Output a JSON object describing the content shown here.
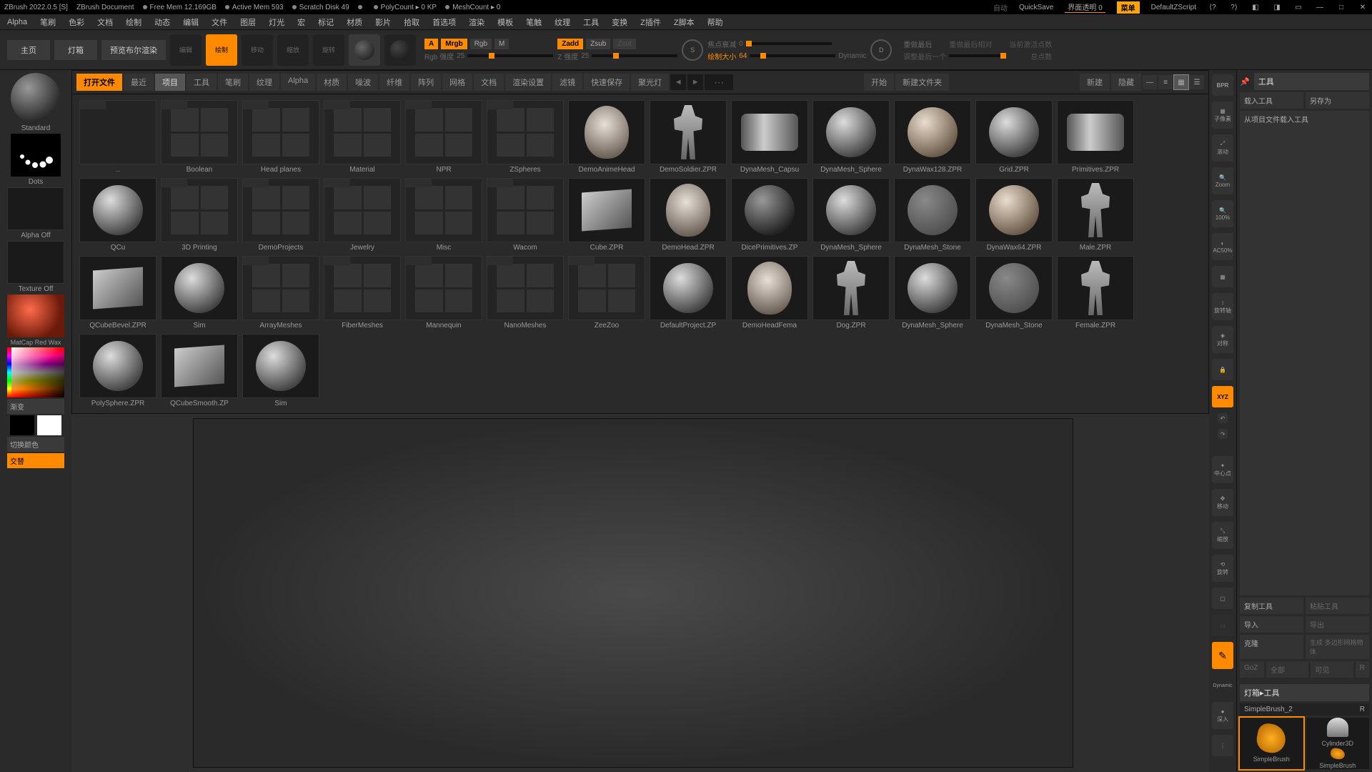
{
  "titlebar": {
    "app": "ZBrush 2022.0.5 [S]",
    "doc": "ZBrush Document",
    "freemem": "Free Mem 12.169GB",
    "activemem": "Active Mem 593",
    "scratch": "Scratch Disk 49",
    "polycount": "PolyCount ▸ 0 KP",
    "meshcount": "MeshCount ▸ 0",
    "auto": "自动",
    "quicksave": "QuickSave",
    "uialpha_label": "界面透明",
    "uialpha_val": "0",
    "menu": "菜单",
    "defaultscript": "DefaultZScript"
  },
  "topmenu": [
    "Alpha",
    "笔刷",
    "色彩",
    "文档",
    "绘制",
    "动态",
    "编辑",
    "文件",
    "图层",
    "灯光",
    "宏",
    "标记",
    "材质",
    "影片",
    "拾取",
    "首选项",
    "渲染",
    "模板",
    "笔触",
    "纹理",
    "工具",
    "变换",
    "Z插件",
    "Z脚本",
    "帮助"
  ],
  "tooltop": {
    "home": "主页",
    "lightbox": "灯箱",
    "bpr_preview": "预览布尔渲染",
    "edit": "编辑",
    "draw": "绘制",
    "move": "移动",
    "scale": "缩放",
    "rotate": "旋转",
    "a_label": "A",
    "mrgb": "Mrgb",
    "rgb": "Rgb",
    "m": "M",
    "zadd": "Zadd",
    "zsub": "Zsub",
    "zcut": "Zcut",
    "rgb_intensity_label": "Rgb 强度",
    "rgb_intensity_val": "25",
    "z_intensity_label": "Z 强度",
    "z_intensity_val": "25",
    "focal_label": "焦点衰减",
    "focal_val": "0",
    "size_label": "绘制大小",
    "size_val": "64",
    "dynamic": "Dynamic",
    "s_circle": "S",
    "d_circle": "D",
    "redo_last": "重做最后",
    "redo_rel": "重做最后相对",
    "cur_active": "当前激活点数",
    "adjust_last": "调整最后一个",
    "total_pts": "总点数"
  },
  "browser": {
    "open": "打开文件",
    "tabs": [
      "最近",
      "项目",
      "工具",
      "笔刷",
      "纹理",
      "Alpha",
      "材质",
      "噪波",
      "纤维",
      "阵列",
      "网格",
      "文档",
      "渲染设置",
      "滤镜",
      "快速保存",
      "聚光灯"
    ],
    "active_tab_index": 1,
    "start": "开始",
    "newfolder": "新建文件夹",
    "new": "新建",
    "hide": "隐藏",
    "items": [
      {
        "label": "..",
        "type": "folder"
      },
      {
        "label": "Boolean",
        "type": "folder-thumb"
      },
      {
        "label": "Head planes",
        "type": "folder-thumb"
      },
      {
        "label": "Material",
        "type": "folder-thumb"
      },
      {
        "label": "NPR",
        "type": "folder-thumb"
      },
      {
        "label": "ZSpheres",
        "type": "folder-thumb"
      },
      {
        "label": "DemoAnimeHead",
        "type": "head"
      },
      {
        "label": "DemoSoldier.ZPR",
        "type": "body"
      },
      {
        "label": "DynaMesh_Capsu",
        "type": "cyl"
      },
      {
        "label": "DynaMesh_Sphere",
        "type": "sphere"
      },
      {
        "label": "DynaWax128.ZPR",
        "type": "sphere-warm"
      },
      {
        "label": "Grid.ZPR",
        "type": "sphere"
      },
      {
        "label": "Primitives.ZPR",
        "type": "cyl"
      },
      {
        "label": "QCu",
        "type": "sphere"
      },
      {
        "label": "3D Printing",
        "type": "folder-grid"
      },
      {
        "label": "DemoProjects",
        "type": "folder-thumb"
      },
      {
        "label": "Jewelry",
        "type": "folder-thumb"
      },
      {
        "label": "Misc",
        "type": "folder-grid"
      },
      {
        "label": "Wacom",
        "type": "folder-grid"
      },
      {
        "label": "Cube.ZPR",
        "type": "cube"
      },
      {
        "label": "DemoHead.ZPR",
        "type": "head"
      },
      {
        "label": "DicePrimitives.ZP",
        "type": "sphere-dark"
      },
      {
        "label": "DynaMesh_Sphere",
        "type": "sphere"
      },
      {
        "label": "DynaMesh_Stone",
        "type": "sphere-noise"
      },
      {
        "label": "DynaWax64.ZPR",
        "type": "sphere-warm"
      },
      {
        "label": "Male.ZPR",
        "type": "body"
      },
      {
        "label": "QCubeBevel.ZPR",
        "type": "cube"
      },
      {
        "label": "Sim",
        "type": "sphere"
      },
      {
        "label": "ArrayMeshes",
        "type": "folder-grid"
      },
      {
        "label": "FiberMeshes",
        "type": "folder-thumb"
      },
      {
        "label": "Mannequin",
        "type": "folder-thumb"
      },
      {
        "label": "NanoMeshes",
        "type": "folder-grid"
      },
      {
        "label": "ZeeZoo",
        "type": "folder-thumb"
      },
      {
        "label": "DefaultProject.ZP",
        "type": "sphere"
      },
      {
        "label": "DemoHeadFema",
        "type": "head"
      },
      {
        "label": "Dog.ZPR",
        "type": "body"
      },
      {
        "label": "DynaMesh_Sphere",
        "type": "sphere"
      },
      {
        "label": "DynaMesh_Stone",
        "type": "sphere-noise"
      },
      {
        "label": "Female.ZPR",
        "type": "body"
      },
      {
        "label": "PolySphere.ZPR",
        "type": "sphere"
      },
      {
        "label": "QCubeSmooth.ZP",
        "type": "cube"
      },
      {
        "label": "Sim",
        "type": "sphere"
      }
    ]
  },
  "left": {
    "brush": "Standard",
    "stroke": "Dots",
    "alpha": "Alpha Off",
    "texture": "Texture Off",
    "material": "MatCap Red Wax",
    "gradient": "渐变",
    "switch": "切换颜色",
    "alt": "交替"
  },
  "rightstrip": {
    "bpr": "BPR",
    "subpix": "子像素",
    "scroll": "滚动",
    "zoom": "Zoom",
    "pct100": "100%",
    "ac50": "AC50%",
    "grid": "网格",
    "float": "旋转轴",
    "lsym": "对称",
    "lock": "锁定",
    "xyz": "XYZ",
    "center": "中心点",
    "move": "移动",
    "scale": "缩放",
    "rotate": "旋转",
    "frame": "框显",
    "dyn": "Dynamic",
    "dynlbl": "深入"
  },
  "rightpanel": {
    "tools_header": "工具",
    "load": "载入工具",
    "saveas": "另存为",
    "import_proj": "从项目文件载入工具",
    "copy": "复制工具",
    "paste": "粘贴工具",
    "import": "导入",
    "export": "导出",
    "clone": "克隆",
    "genpoly": "生成 多边形网格物体",
    "goz": "GoZ",
    "all": "全部",
    "visible": "可见",
    "r": "R",
    "section": "灯箱▸工具",
    "brushname": "SimpleBrush_2",
    "tool1": "SimpleBrush",
    "tool2": "Cylinder3D",
    "tool3": "SimpleBrush"
  }
}
